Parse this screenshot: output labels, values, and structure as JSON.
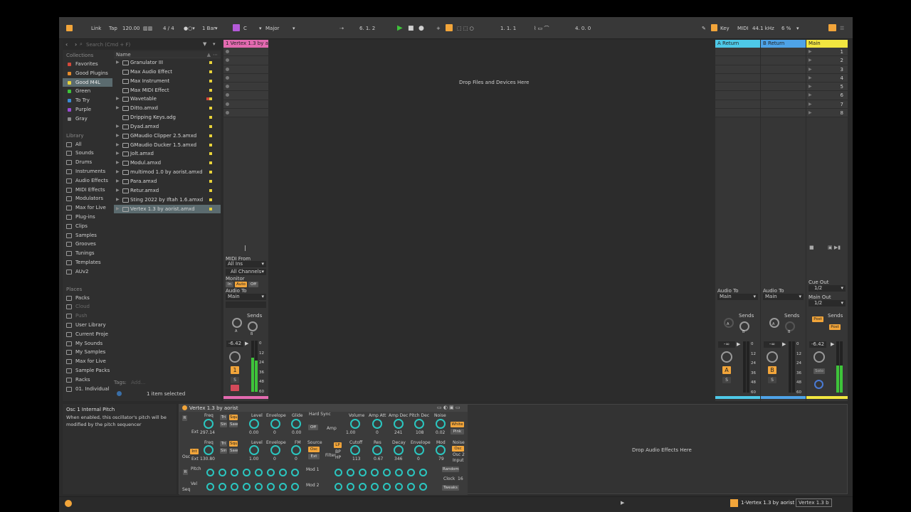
{
  "toolbar": {
    "link": "Link",
    "tap": "Tap",
    "tempo": "120.00",
    "signature": "4 / 4",
    "quantize": "1 Bar",
    "key_root": "C",
    "key_scale": "Major",
    "position": "6.  1.  2",
    "loop_start": "1.  1.  1",
    "loop_length": "4.  0.  0",
    "key": "Key",
    "midi": "MIDI",
    "sample_rate": "44.1 kHz",
    "cpu": "6 %"
  },
  "browser": {
    "search_placeholder": "Search (Cmd + F)",
    "collections_title": "Collections",
    "collections": [
      {
        "label": "Favorites",
        "color": "#d4483a"
      },
      {
        "label": "Good Plugins",
        "color": "#e88b2a"
      },
      {
        "label": "Good M4L",
        "color": "#e8d23a"
      },
      {
        "label": "Green",
        "color": "#3ec43a"
      },
      {
        "label": "To Try",
        "color": "#3a8ad4"
      },
      {
        "label": "Purple",
        "color": "#9a4ad4"
      },
      {
        "label": "Gray",
        "color": "#8a8a8a"
      }
    ],
    "library_title": "Library",
    "library": [
      "All",
      "Sounds",
      "Drums",
      "Instruments",
      "Audio Effects",
      "MIDI Effects",
      "Modulators",
      "Max for Live",
      "Plug-ins",
      "Clips",
      "Samples",
      "Grooves",
      "Tunings",
      "Templates",
      "AUv2"
    ],
    "places_title": "Places",
    "places": [
      "Packs",
      "Cloud",
      "Push",
      "User Library",
      "Current Proje",
      "My Sounds",
      "My Samples",
      "Max for Live",
      "Sample Packs",
      "Racks",
      "01. Individual"
    ],
    "name_header": "Name",
    "files": [
      "Granulator III",
      "Max Audio Effect",
      "Max Instrument",
      "Max MIDI Effect",
      "Wavetable",
      "Ditto.amxd",
      "Dripping Keys.adg",
      "Dyad.amxd",
      "GMaudio Clipper 2.5.amxd",
      "GMaudio Ducker 1.5.amxd",
      "Jolt.amxd",
      "Modul.amxd",
      "multimod 1.0 by aorist.amxd",
      "Para.amxd",
      "Retur.amxd",
      "Sting 2022 by Iftah 1.6.amxd",
      "Vertex 1.3 by aorist.amxd"
    ],
    "tags_label": "Tags:",
    "tags_add": "Add...",
    "selection_status": "1 item selected"
  },
  "session": {
    "track_name": "1 Vertex 1.3 by ao",
    "drop_files": "Drop Files and Devices Here",
    "return_a": "A Return",
    "return_b": "B Return",
    "main": "Main",
    "scenes": [
      "1",
      "2",
      "3",
      "4",
      "5",
      "6",
      "7",
      "8"
    ],
    "midi_from": "MIDI From",
    "all_ins": "All Ins",
    "all_channels": "All Channels",
    "monitor": "Monitor",
    "mon_in": "In",
    "mon_auto": "Auto",
    "mon_off": "Off",
    "audio_to": "Audio To",
    "audio_to_value": "Main",
    "sends": "Sends",
    "send_a": "A",
    "send_b": "B",
    "track_volume": "-6.42",
    "return_volume": "-∞",
    "main_volume": "-6.42",
    "track_number": "1",
    "solo": "S",
    "return_a_letter": "A",
    "return_b_letter": "B",
    "cue_out": "Cue Out",
    "cue_out_value": "1/2",
    "main_out": "Main Out",
    "main_out_value": "1/2",
    "post": "Post",
    "solo_main": "Solo",
    "meter_scale": [
      "0",
      "12",
      "24",
      "36",
      "48",
      "60"
    ]
  },
  "info": {
    "title": "Osc 1 Internal Pitch",
    "text": "When enabled, this oscillator's pitch will be modified by the pitch sequencer"
  },
  "device": {
    "name": "Vertex 1.3 by aorist",
    "drop_effects": "Drop Audio Effects Here",
    "osc1": {
      "freq": "297.14",
      "level": "0.00",
      "env": "0",
      "glide": "0.00",
      "hard_sync": "Hard Sync",
      "sync_val": "Off"
    },
    "osc2": {
      "freq": "130.80",
      "level": "1.00",
      "env": "0",
      "fm": "0",
      "source": "Source",
      "src_val": "Osc 1",
      "ext": "Ext"
    },
    "amp": {
      "volume": "1.00",
      "att": "0",
      "dec": "241",
      "pitch_dec": "108",
      "noise": "0.02",
      "noise_white": "White",
      "noise_pink": "Pink"
    },
    "filter": {
      "cutoff": "113",
      "res": "0.67",
      "decay": "346",
      "env": "0",
      "mod": "79",
      "lp": "LP",
      "bp": "BP",
      "hp": "HP"
    },
    "labels": {
      "freq": "Freq",
      "level": "Level",
      "envelope": "Envelope",
      "glide": "Glide",
      "fm": "FM",
      "volume": "Volume",
      "amp_att": "Amp Att",
      "amp_dec": "Amp Dec",
      "pitch_dec": "Pitch Dec",
      "noise": "Noise",
      "cutoff": "Cutoff",
      "res": "Res",
      "decay": "Decay",
      "mod": "Mod",
      "tri": "Tri",
      "sin": "Sin",
      "saw": "Saw",
      "squ": "Squ",
      "int": "Int",
      "ext": "Ext",
      "osc": "Osc",
      "amp": "Amp",
      "filter": "Filter",
      "pitch": "Pitch",
      "vel": "Vel",
      "seq": "Seq",
      "mod1": "Mod 1",
      "mod2": "Mod 2",
      "random": "Random",
      "clock": "Clock",
      "clock_val": "16",
      "tweaks": "Tweaks",
      "noise_sel": "Noise",
      "osc1": "Osc 1",
      "osc2": "Osc 2",
      "input": "Input",
      "r": "R",
      "q": "Q"
    }
  },
  "status": {
    "track": "1-Vertex 1.3 by aorist",
    "device_short": "Vertex 1.3 b"
  }
}
